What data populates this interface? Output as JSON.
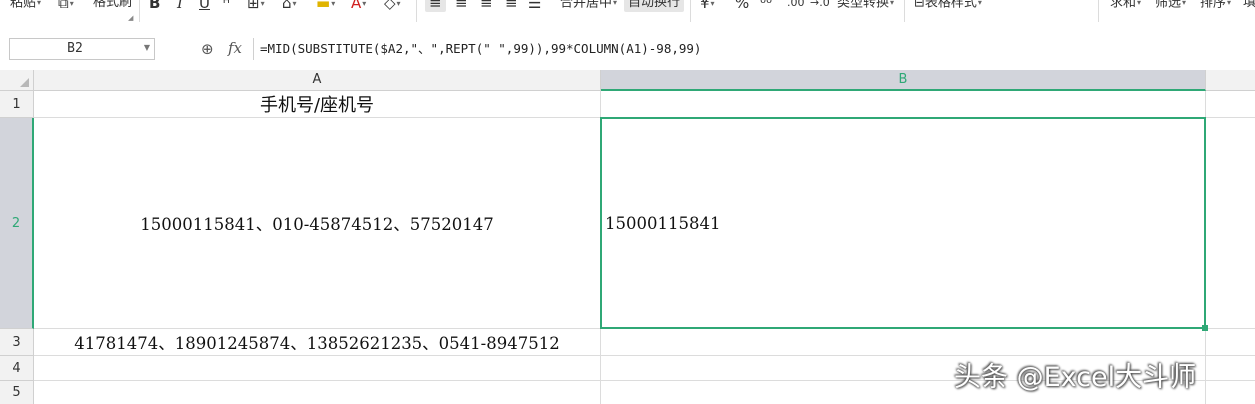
{
  "ribbon": {
    "paste": "粘贴",
    "format_painter": "格式刷",
    "bold": "B",
    "italic": "I",
    "underline": "U",
    "merge_center": "合并居中",
    "wrap_text": "自动换行",
    "currency": "¥",
    "percent": "%",
    "type_convert": "类型转换",
    "table_style": "表格样式",
    "sum": "求和",
    "filter": "筛选",
    "sort": "排序",
    "fill": "填"
  },
  "formula_bar": {
    "name_box": "B2",
    "fx": "fx",
    "formula": "=MID(SUBSTITUTE($A2,\"、\",REPT(\" \",99)),99*COLUMN(A1)-98,99)"
  },
  "columns": [
    "A",
    "B"
  ],
  "rows": [
    "1",
    "2",
    "3",
    "4",
    "5"
  ],
  "cells": {
    "A1": "手机号/座机号",
    "A2": "15000115841、010-45874512、57520147",
    "B2": "15000115841",
    "A3": "41781474、18901245874、13852621235、0541-8947512"
  },
  "watermark": "头条 @Excel大斗师",
  "colors": {
    "selection": "#2fa876",
    "header_bg": "#f2f2f2",
    "header_selected_bg": "#d2d4db"
  }
}
